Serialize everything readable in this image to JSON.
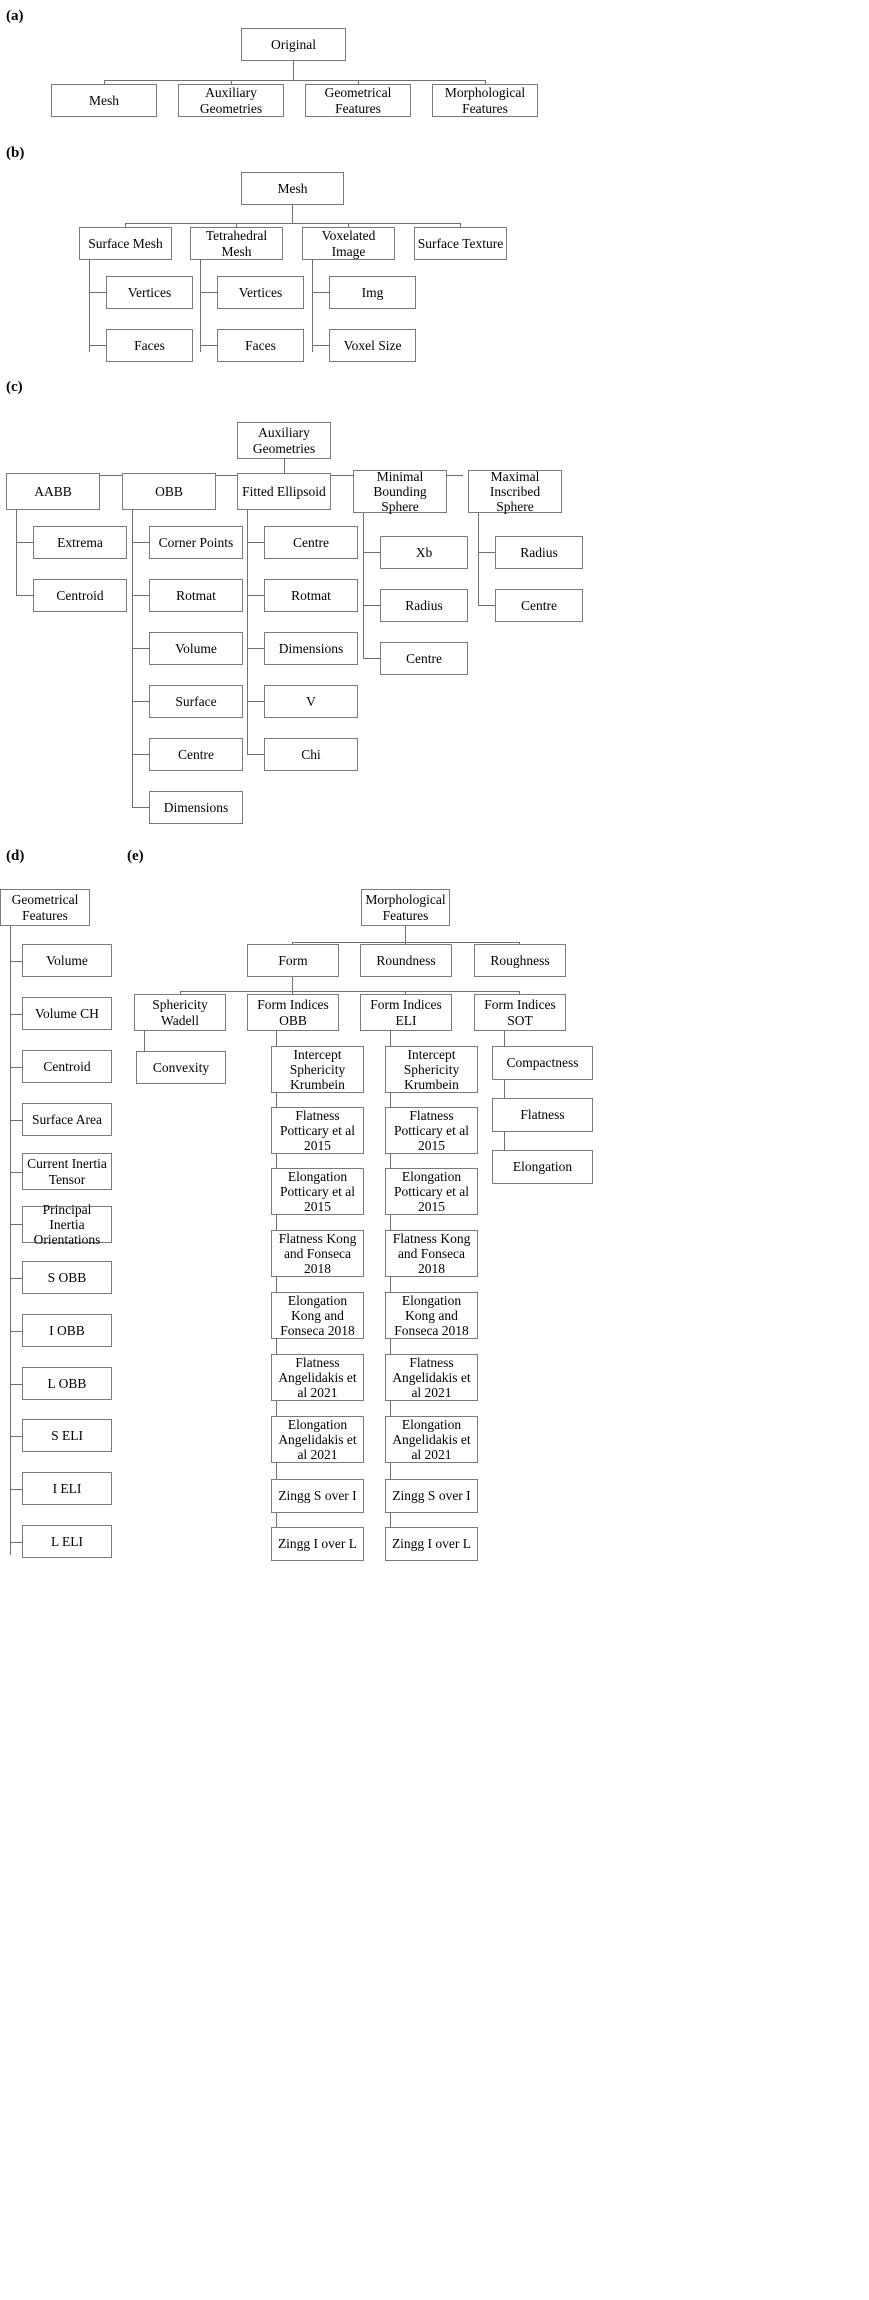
{
  "figure": {
    "type": "tree-diagram",
    "panels": [
      {
        "label": "(a)",
        "root": "Original",
        "children": [
          "Mesh",
          "Auxiliary Geometries",
          "Geometrical Features",
          "Morphological Features"
        ]
      },
      {
        "label": "(b)",
        "root": "Mesh",
        "children": [
          "Surface Mesh",
          "Tetrahedral Mesh",
          "Voxelated Image",
          "Surface Texture"
        ],
        "grandchildren": [
          [
            "Vertices",
            "Faces"
          ],
          [
            "Vertices",
            "Faces"
          ],
          [
            "Img",
            "Voxel Size"
          ],
          []
        ]
      },
      {
        "label": "(c)",
        "root": "Auxiliary Geometries",
        "children": [
          "AABB",
          "OBB",
          "Fitted Ellipsoid",
          "Minimal Bounding Sphere",
          "Maximal Inscribed Sphere"
        ],
        "grandchildren": [
          [
            "Extrema",
            "Centroid"
          ],
          [
            "Corner Points",
            "Rotmat",
            "Volume",
            "Surface",
            "Centre",
            "Dimensions"
          ],
          [
            "Centre",
            "Rotmat",
            "Dimensions",
            "V",
            "Chi"
          ],
          [
            "Xb",
            "Radius",
            "Centre"
          ],
          [
            "Radius",
            "Centre"
          ]
        ]
      },
      {
        "label": "(d)",
        "root": "Geometrical Features",
        "children": [
          "Volume",
          "Volume CH",
          "Centroid",
          "Surface Area",
          "Current Inertia Tensor",
          "Principal Inertia Orientations",
          "S OBB",
          "I OBB",
          "L OBB",
          "S ELI",
          "I ELI",
          "L ELI"
        ]
      },
      {
        "label": "(e)",
        "root": "Morphological Features",
        "children": [
          "Form",
          "Roundness",
          "Roughness"
        ],
        "form_children": [
          "Sphericity Wadell",
          "Form Indices OBB",
          "Form Indices ELI",
          "Form Indices SOT"
        ],
        "sphericity_children": [
          "Convexity"
        ],
        "obb_children": [
          "Intercept Sphericity Krumbein",
          "Flatness Potticary et al 2015",
          "Elongation Potticary et al 2015",
          "Flatness Kong and Fonseca 2018",
          "Elongation Kong and Fonseca 2018",
          "Flatness Angelidakis et al 2021",
          "Elongation Angelidakis et al 2021",
          "Zingg S over I",
          "Zingg I over L"
        ],
        "eli_children": [
          "Intercept Sphericity Krumbein",
          "Flatness Potticary et al 2015",
          "Elongation Potticary et al 2015",
          "Flatness Kong and Fonseca 2018",
          "Elongation Kong and Fonseca 2018",
          "Flatness Angelidakis et al 2021",
          "Elongation Angelidakis et al 2021",
          "Zingg S over I",
          "Zingg I over L"
        ],
        "sot_children": [
          "Compactness",
          "Flatness",
          "Elongation"
        ]
      }
    ]
  },
  "labels": {
    "a": "(a)",
    "b": "(b)",
    "c": "(c)",
    "d": "(d)",
    "e": "(e)"
  },
  "nodes": {
    "a_root": "Original",
    "a_c1": "Mesh",
    "a_c2": "Auxiliary\nGeometries",
    "a_c3": "Geometrical\nFeatures",
    "a_c4": "Morphological\nFeatures",
    "b_root": "Mesh",
    "b_c1": "Surface Mesh",
    "b_c2": "Tetrahedral\nMesh",
    "b_c3": "Voxelated\nImage",
    "b_c4": "Surface Texture",
    "b_c1_1": "Vertices",
    "b_c1_2": "Faces",
    "b_c2_1": "Vertices",
    "b_c2_2": "Faces",
    "b_c3_1": "Img",
    "b_c3_2": "Voxel Size",
    "c_root": "Auxiliary\nGeometries",
    "c_c1": "AABB",
    "c_c2": "OBB",
    "c_c3": "Fitted Ellipsoid",
    "c_c4": "Minimal\nBounding\nSphere",
    "c_c5": "Maximal\nInscribed\nSphere",
    "c_c1_1": "Extrema",
    "c_c1_2": "Centroid",
    "c_c2_1": "Corner Points",
    "c_c2_2": "Rotmat",
    "c_c2_3": "Volume",
    "c_c2_4": "Surface",
    "c_c2_5": "Centre",
    "c_c2_6": "Dimensions",
    "c_c3_1": "Centre",
    "c_c3_2": "Rotmat",
    "c_c3_3": "Dimensions",
    "c_c3_4": "V",
    "c_c3_5": "Chi",
    "c_c4_1": "Xb",
    "c_c4_2": "Radius",
    "c_c4_3": "Centre",
    "c_c5_1": "Radius",
    "c_c5_2": "Centre",
    "d_root": "Geometrical\nFeatures",
    "d_1": "Volume",
    "d_2": "Volume CH",
    "d_3": "Centroid",
    "d_4": "Surface Area",
    "d_5": "Current Inertia\nTensor",
    "d_6": "Principal Inertia\nOrientations",
    "d_7": "S OBB",
    "d_8": "I OBB",
    "d_9": "L OBB",
    "d_10": "S ELI",
    "d_11": "I ELI",
    "d_12": "L ELI",
    "e_root": "Morphological\nFeatures",
    "e_c1": "Form",
    "e_c2": "Roundness",
    "e_c3": "Roughness",
    "e_f1": "Sphericity\nWadell",
    "e_f2": "Form Indices\nOBB",
    "e_f3": "Form Indices\nELI",
    "e_f4": "Form Indices\nSOT",
    "e_f1_1": "Convexity",
    "e_obb_1": "Intercept\nSphericity\nKrumbein",
    "e_obb_2": "Flatness\nPotticary et al\n2015",
    "e_obb_3": "Elongation\nPotticary et al\n2015",
    "e_obb_4": "Flatness Kong\nand Fonseca\n2018",
    "e_obb_5": "Elongation\nKong and\nFonseca 2018",
    "e_obb_6": "Flatness\nAngelidakis et\nal 2021",
    "e_obb_7": "Elongation\nAngelidakis et\nal 2021",
    "e_obb_8": "Zingg S over I",
    "e_obb_9": "Zingg I over L",
    "e_eli_1": "Intercept\nSphericity\nKrumbein",
    "e_eli_2": "Flatness\nPotticary et al\n2015",
    "e_eli_3": "Elongation\nPotticary et al\n2015",
    "e_eli_4": "Flatness Kong\nand Fonseca\n2018",
    "e_eli_5": "Elongation\nKong and\nFonseca 2018",
    "e_eli_6": "Flatness\nAngelidakis et\nal 2021",
    "e_eli_7": "Elongation\nAngelidakis et\nal 2021",
    "e_eli_8": "Zingg S over I",
    "e_eli_9": "Zingg I over L",
    "e_sot_1": "Compactness",
    "e_sot_2": "Flatness",
    "e_sot_3": "Elongation"
  },
  "colors": {
    "box_border": "#7a7a7a",
    "line": "#6f6f6f",
    "text": "#000000",
    "background": "#ffffff"
  }
}
